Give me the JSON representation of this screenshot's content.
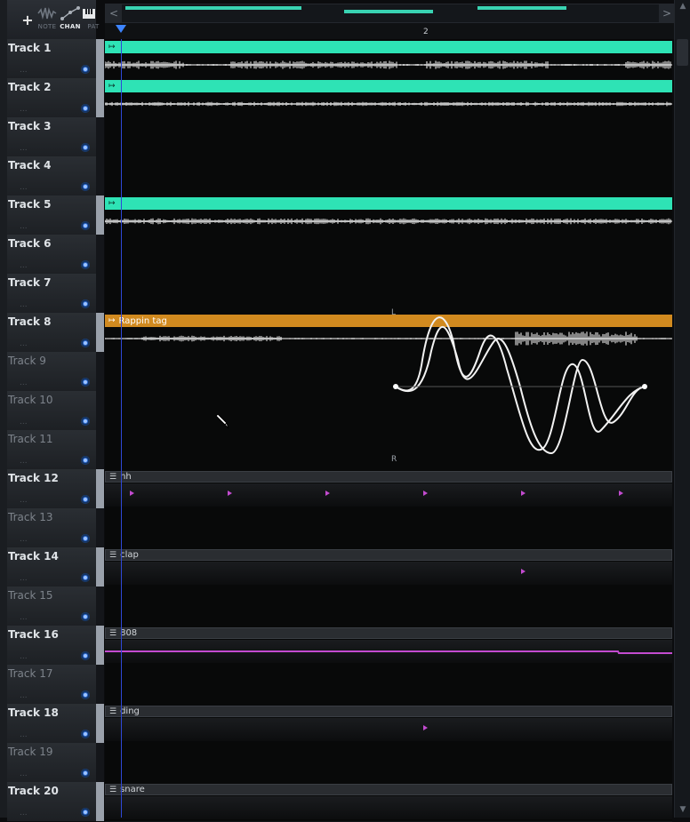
{
  "header": {
    "add_label": "+",
    "modes": [
      {
        "id": "note",
        "label": "NOTE",
        "icon": "waveform-icon",
        "active": false
      },
      {
        "id": "chan",
        "label": "CHAN",
        "icon": "automation-curve-icon",
        "active": true
      },
      {
        "id": "pat",
        "label": "PAT",
        "icon": "piano-keys-icon",
        "active": false
      }
    ]
  },
  "ruler": {
    "bar_number": "2"
  },
  "overview": {
    "scroll_left": "<",
    "scroll_right": ">"
  },
  "tracks": [
    {
      "label": "Track 1",
      "dots": "...",
      "dim": false,
      "clip": {
        "type": "audio",
        "name": ""
      }
    },
    {
      "label": "Track 2",
      "dots": "...",
      "dim": false,
      "clip": {
        "type": "audio",
        "name": ""
      }
    },
    {
      "label": "Track 3",
      "dots": "...",
      "dim": false,
      "clip": null
    },
    {
      "label": "Track 4",
      "dots": "...",
      "dim": false,
      "clip": null
    },
    {
      "label": "Track 5",
      "dots": "...",
      "dim": false,
      "clip": {
        "type": "audio",
        "name": ""
      }
    },
    {
      "label": "Track 6",
      "dots": "...",
      "dim": false,
      "clip": null
    },
    {
      "label": "Track 7",
      "dots": "...",
      "dim": false,
      "clip": null
    },
    {
      "label": "Track 8",
      "dots": "...",
      "dim": false,
      "clip": {
        "type": "rap",
        "name": "Rappin tag"
      }
    },
    {
      "label": "Track 9",
      "dots": "...",
      "dim": true,
      "clip": null
    },
    {
      "label": "Track 10",
      "dots": "...",
      "dim": true,
      "clip": null
    },
    {
      "label": "Track 11",
      "dots": "...",
      "dim": true,
      "clip": null
    },
    {
      "label": "Track 12",
      "dots": "...",
      "dim": false,
      "clip": {
        "type": "pattern",
        "name": "hh"
      }
    },
    {
      "label": "Track 13",
      "dots": "...",
      "dim": true,
      "clip": null
    },
    {
      "label": "Track 14",
      "dots": "...",
      "dim": false,
      "clip": {
        "type": "pattern",
        "name": "clap"
      }
    },
    {
      "label": "Track 15",
      "dots": "...",
      "dim": true,
      "clip": null
    },
    {
      "label": "Track 16",
      "dots": "...",
      "dim": false,
      "clip": {
        "type": "pattern",
        "name": "808"
      }
    },
    {
      "label": "Track 17",
      "dots": "...",
      "dim": true,
      "clip": null
    },
    {
      "label": "Track 18",
      "dots": "...",
      "dim": false,
      "clip": {
        "type": "pattern",
        "name": "ding"
      }
    },
    {
      "label": "Track 19",
      "dots": "...",
      "dim": true,
      "clip": null
    },
    {
      "label": "Track 20",
      "dots": "...",
      "dim": false,
      "clip": {
        "type": "pattern",
        "name": "snare"
      }
    }
  ],
  "pan_overlay": {
    "left_label": "L",
    "right_label": "R"
  },
  "colors": {
    "audio_clip": "#2ee3b5",
    "rap_clip": "#d18a1f",
    "note_marker": "#c34bd0",
    "playhead": "#2f48d8"
  }
}
